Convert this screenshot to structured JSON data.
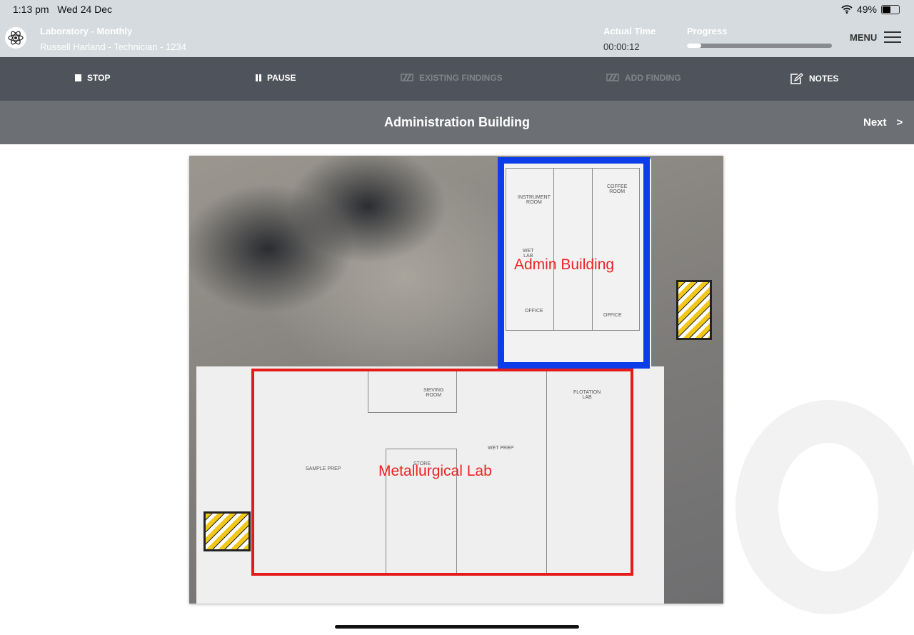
{
  "status_bar": {
    "time": "1:13 pm",
    "date": "Wed 24 Dec",
    "battery": "49%",
    "battery_level": 0.49
  },
  "header": {
    "title": "Laboratory  - Monthly",
    "subtitle": "Russell Harland - Technician - 1234",
    "actual_time_label": "Actual Time",
    "actual_time": "00:00:12",
    "progress_label": "Progress",
    "progress_fraction": 0.1,
    "menu_label": "MENU"
  },
  "toolbar": {
    "stop": "STOP",
    "pause": "PAUSE",
    "existing_findings": "EXISTING FINDINGS",
    "add_finding": "ADD FINDING",
    "notes": "NOTES"
  },
  "page": {
    "title": "Administration Building",
    "next": "Next"
  },
  "map": {
    "area_labels": {
      "admin": "Admin Building",
      "lab": "Metallurgical Lab"
    },
    "rooms": {
      "instrument": "INSTRUMENT\nROOM",
      "coffee": "COFFEE\nROOM",
      "wet_lab": "WET\nLAB",
      "office1": "OFFICE",
      "office2": "OFFICE",
      "sieving": "SIEVING\nROOM",
      "flotation": "FLOTATION\nLAB",
      "wet_prep": "WET PREP",
      "sample_prep": "SAMPLE PREP",
      "store": "STORE"
    }
  },
  "colors": {
    "admin_outline": "#0b3ee8",
    "lab_outline": "#e51b1b",
    "hazard": "#f2c718"
  }
}
